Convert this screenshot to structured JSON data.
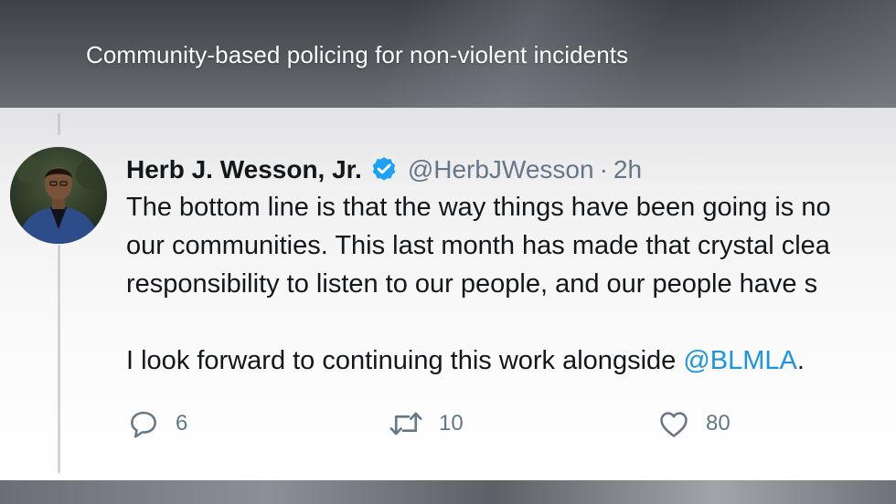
{
  "banner": {
    "caption": "Community-based policing for non-violent incidents"
  },
  "tweet": {
    "author_name": "Herb J. Wesson, Jr.",
    "handle": "@HerbJWesson",
    "separator": "·",
    "time": "2h",
    "verified": true,
    "lines": [
      "The bottom line is that the way things have been going is no",
      "our communities. This last month has made that crystal clea",
      "responsibility to listen to our people, and our people have s"
    ],
    "closing_text": "I look forward to continuing this work alongside ",
    "mention": "@BLMLA",
    "closing_punct": ".",
    "actions": {
      "reply_icon": "reply-icon",
      "reply_count": "6",
      "retweet_icon": "retweet-icon",
      "retweet_count": "10",
      "like_icon": "heart-icon",
      "like_count": "80"
    }
  },
  "colors": {
    "accent": "#1b95e0",
    "verified_badge": "#1da1f2",
    "secondary_text": "#657786",
    "primary_text": "#14171a"
  }
}
